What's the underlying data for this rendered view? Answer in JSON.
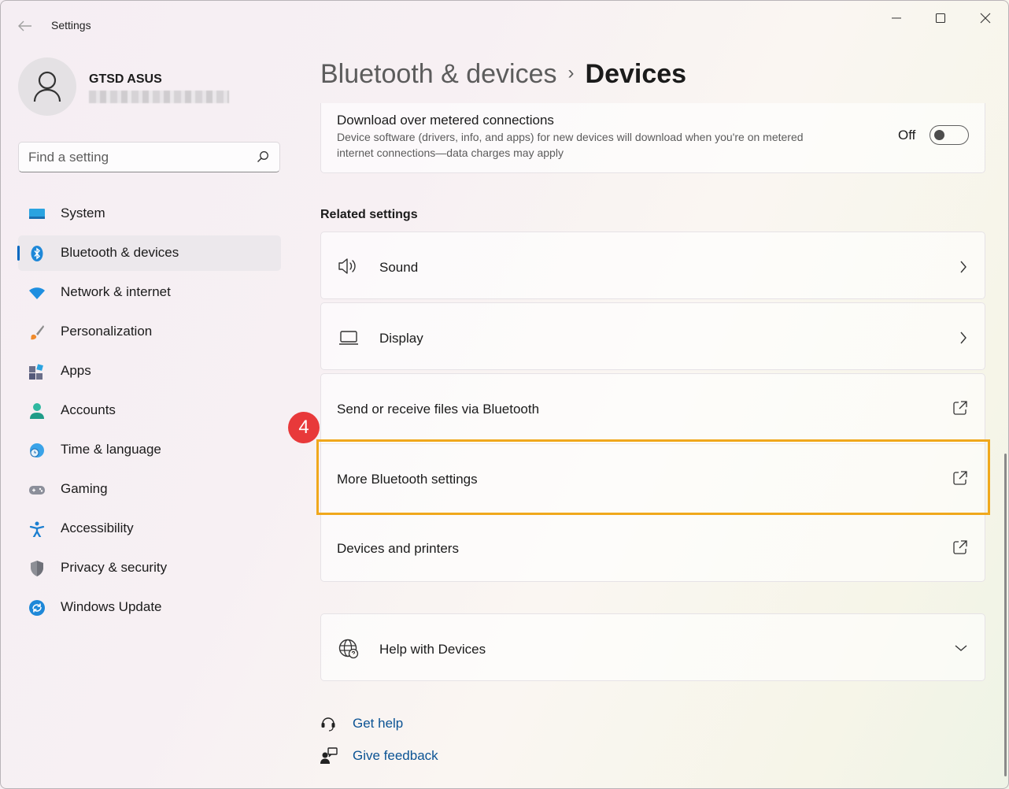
{
  "window": {
    "title": "Settings"
  },
  "user": {
    "name": "GTSD ASUS"
  },
  "search": {
    "placeholder": "Find a setting"
  },
  "sidebar": {
    "items": [
      {
        "label": "System",
        "icon": "system-icon",
        "active": false
      },
      {
        "label": "Bluetooth & devices",
        "icon": "bluetooth-icon",
        "active": true
      },
      {
        "label": "Network & internet",
        "icon": "wifi-icon",
        "active": false
      },
      {
        "label": "Personalization",
        "icon": "brush-icon",
        "active": false
      },
      {
        "label": "Apps",
        "icon": "apps-icon",
        "active": false
      },
      {
        "label": "Accounts",
        "icon": "accounts-icon",
        "active": false
      },
      {
        "label": "Time & language",
        "icon": "globe-clock-icon",
        "active": false
      },
      {
        "label": "Gaming",
        "icon": "gamepad-icon",
        "active": false
      },
      {
        "label": "Accessibility",
        "icon": "accessibility-icon",
        "active": false
      },
      {
        "label": "Privacy & security",
        "icon": "shield-icon",
        "active": false
      },
      {
        "label": "Windows Update",
        "icon": "update-icon",
        "active": false
      }
    ]
  },
  "breadcrumb": {
    "parent": "Bluetooth & devices",
    "separator": "›",
    "current": "Devices"
  },
  "metered": {
    "title": "Download over metered connections",
    "description": "Device software (drivers, info, and apps) for new devices will download when you're on metered internet connections—data charges may apply",
    "toggle_label": "Off",
    "toggle_on": false
  },
  "related": {
    "heading": "Related settings",
    "sound": "Sound",
    "display": "Display",
    "send_receive": "Send or receive files via Bluetooth",
    "more_bluetooth": "More Bluetooth settings",
    "devices_printers": "Devices and printers",
    "help": "Help with Devices"
  },
  "annotation": {
    "step": "4",
    "color": "#f0a81c",
    "badge_color": "#e8393a"
  },
  "footer": {
    "get_help": "Get help",
    "give_feedback": "Give feedback"
  },
  "colors": {
    "accent": "#0067c0",
    "link": "#0b5394"
  }
}
